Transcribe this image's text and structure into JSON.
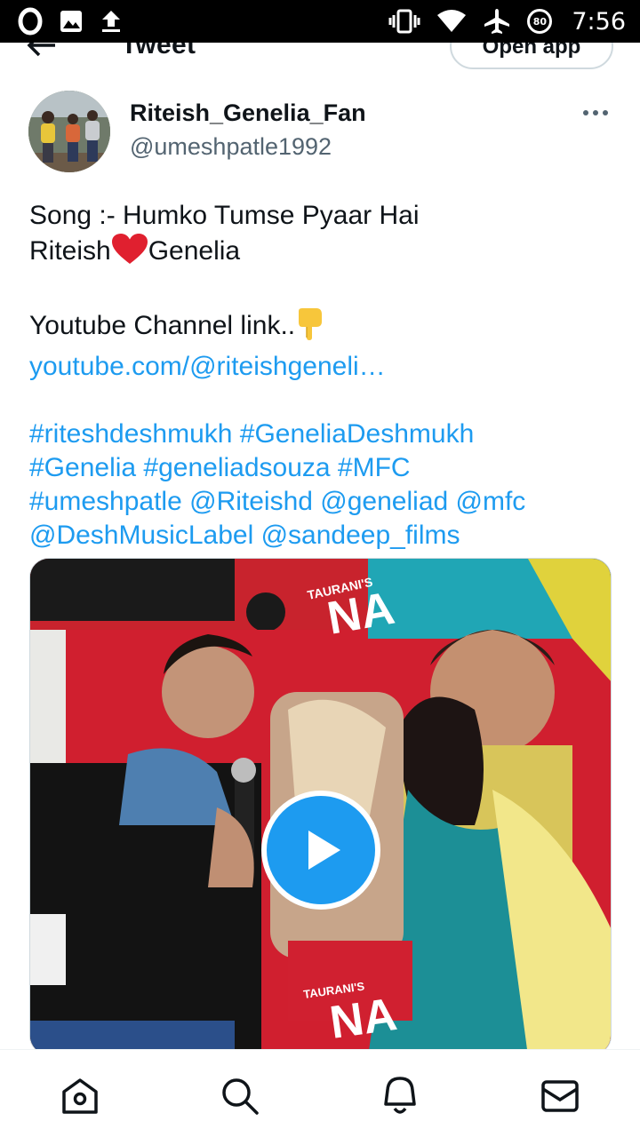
{
  "status_bar": {
    "time": "7:56",
    "battery_level": "80",
    "left_icons": [
      "opera-icon",
      "image-icon",
      "upload-icon"
    ],
    "right_icons": [
      "vibrate-icon",
      "wifi-icon",
      "airplane-icon",
      "battery-icon"
    ]
  },
  "header": {
    "title": "Tweet",
    "open_app_label": "Open app"
  },
  "tweet": {
    "display_name": "Riteish_Genelia_Fan",
    "username": "@umeshpatle1992",
    "line1": "Song :- Humko Tumse Pyaar Hai",
    "line2_a": "Riteish",
    "line2_b": "Genelia",
    "line3": "Youtube Channel link..",
    "url": "youtube.com/@riteishgeneli…",
    "hashtags_line1": "#riteshdeshmukh #GeneliaDeshmukh",
    "hashtags_line2": "#Genelia #geneliadsouza #MFC",
    "hashtags_line3": "#umeshpatle @Riteishd @geneliad @mfc",
    "hashtags_line4": "@DeshMusicLabel @sandeep_films",
    "media_poster_text": "TAURANI'S",
    "media_poster_text_big": "NA"
  },
  "bottom_nav": {
    "items": [
      "home-icon",
      "search-icon",
      "notifications-icon",
      "messages-icon"
    ]
  },
  "colors": {
    "link": "#1d9bf0",
    "secondary_text": "#536471",
    "play_button": "#1d9bf0"
  }
}
